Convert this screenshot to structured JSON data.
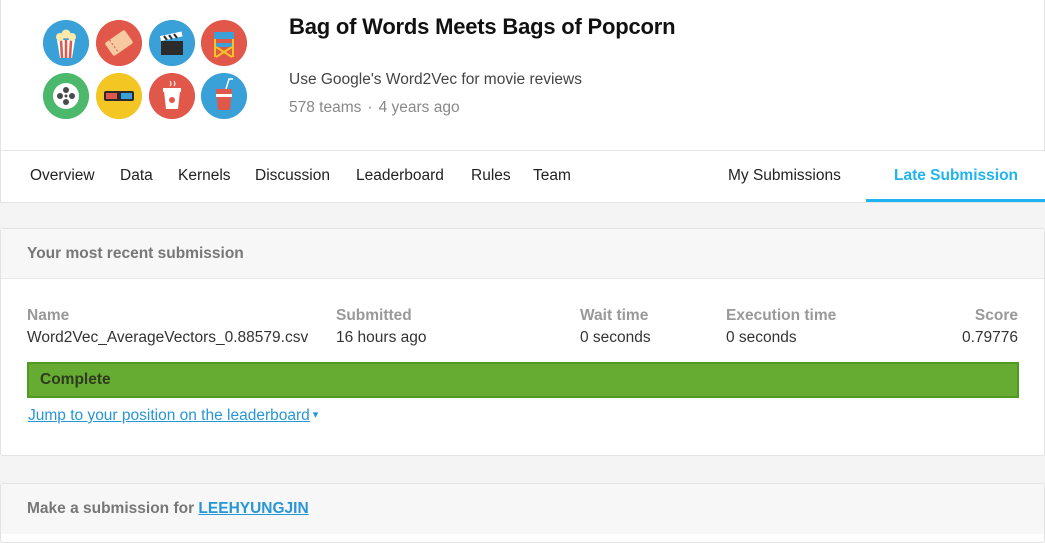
{
  "competition": {
    "title": "Bag of Words Meets Bags of Popcorn",
    "subtitle": "Use Google's Word2Vec for movie reviews",
    "teams": "578 teams",
    "separator": "·",
    "age": "4 years ago"
  },
  "logo_icons": [
    {
      "name": "popcorn-icon",
      "color": "#3aa0d8"
    },
    {
      "name": "ticket-icon",
      "color": "#e1584b"
    },
    {
      "name": "clapperboard-icon",
      "color": "#3aa0d8"
    },
    {
      "name": "directors-chair-icon",
      "color": "#e1584b"
    },
    {
      "name": "film-reel-icon",
      "color": "#4cb86b"
    },
    {
      "name": "3d-glasses-icon",
      "color": "#f3c623"
    },
    {
      "name": "coffee-cup-icon",
      "color": "#e1584b"
    },
    {
      "name": "soda-cup-icon",
      "color": "#3aa0d8"
    }
  ],
  "tabs": [
    {
      "label": "Overview"
    },
    {
      "label": "Data"
    },
    {
      "label": "Kernels"
    },
    {
      "label": "Discussion"
    },
    {
      "label": "Leaderboard"
    },
    {
      "label": "Rules"
    },
    {
      "label": "Team"
    },
    {
      "label": "My Submissions"
    },
    {
      "label": "Late Submission",
      "active": true
    }
  ],
  "recent": {
    "heading": "Your most recent submission",
    "columns": {
      "name": {
        "label": "Name",
        "value": "Word2Vec_AverageVectors_0.88579.csv"
      },
      "submitted": {
        "label": "Submitted",
        "value": "16 hours ago"
      },
      "wait": {
        "label": "Wait time",
        "value": "0 seconds"
      },
      "execution": {
        "label": "Execution time",
        "value": "0 seconds"
      },
      "score": {
        "label": "Score",
        "value": "0.79776"
      }
    },
    "status": "Complete",
    "status_color": "#66ac32",
    "jump_link": "Jump to your position on the leaderboard"
  },
  "make_submission": {
    "prefix": "Make a submission for ",
    "user": "LEEHYUNGJIN"
  },
  "accent_color": "#1fb4f0"
}
